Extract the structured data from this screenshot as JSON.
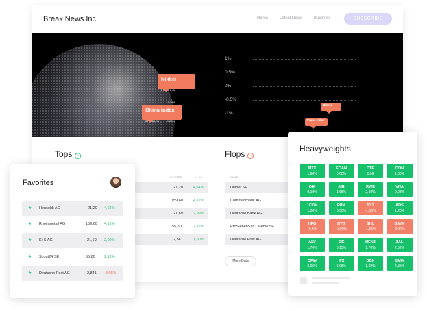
{
  "site": {
    "brand": "Break News Inc",
    "nav": [
      "Home",
      "Latest News",
      "Business"
    ],
    "subscribe": "SUBSCRIBE"
  },
  "hero": {
    "tags": [
      {
        "title": "Nikkei",
        "value": "379.561,45",
        "change": "-1,34%"
      },
      {
        "title": "China Index",
        "value": "379.561,45",
        "change": "-1,09%"
      },
      {
        "title": "Nikkei",
        "value": "379.561,45",
        "change": "-1,34%"
      },
      {
        "title": "China Index",
        "value": "379.561,45",
        "change": "-1,09%"
      }
    ],
    "axis": [
      "1%",
      "0,5%",
      "0%",
      "-0,5%",
      "-1%"
    ]
  },
  "tops": {
    "title": "Tops",
    "headers": [
      "LETZTER",
      "+/- %"
    ],
    "rows": [
      {
        "last": "21,20",
        "change": "4,64%"
      },
      {
        "last": "159,60",
        "change": "4,12%"
      },
      {
        "last": "21,69",
        "change": "2,99%"
      },
      {
        "last": "55,80",
        "change": "2,12%"
      },
      {
        "last": "2,541",
        "change": "1,60%"
      }
    ]
  },
  "flops": {
    "title": "Flops",
    "header": "NAME",
    "rows": [
      "Uniper SE",
      "Commerzbank AG",
      "Deutsche Bank AG",
      "ProSiebenSat 1 Media SE",
      "Deutsche Post AG"
    ],
    "more": "More Data"
  },
  "favorites": {
    "title": "Favorites",
    "rows": [
      {
        "name": "Hensoldt AG",
        "last": "21,20",
        "change": "4,64%",
        "dir": "up"
      },
      {
        "name": "Rheinmetall AG",
        "last": "159,60",
        "change": "4,12%",
        "dir": "up"
      },
      {
        "name": "K+S AG",
        "last": "21,69",
        "change": "2,99%",
        "dir": "up"
      },
      {
        "name": "Scout24 SE",
        "last": "55,80",
        "change": "2,12%",
        "dir": "up"
      },
      {
        "name": "Deutsche Post AG",
        "last": "2,841",
        "change": "-3,65%",
        "dir": "down"
      }
    ]
  },
  "heavyweights": {
    "title": "Heavyweights",
    "tiles": [
      {
        "name": "MTX",
        "change": "1,60%",
        "dir": "up"
      },
      {
        "name": "EOAN",
        "change": "0,60%",
        "dir": "up"
      },
      {
        "name": "DTE",
        "change": "0,09",
        "dir": "up"
      },
      {
        "name": "CON",
        "change": "1,60%",
        "dir": "up"
      },
      {
        "name": "QIA",
        "change": "0,19%",
        "dir": "up"
      },
      {
        "name": "AIR",
        "change": "1,68%",
        "dir": "up"
      },
      {
        "name": "RWE",
        "change": "2,60%",
        "dir": "up"
      },
      {
        "name": "VNA",
        "change": "0,23%",
        "dir": "up"
      },
      {
        "name": "1COV",
        "change": "1,30%",
        "dir": "up"
      },
      {
        "name": "PUM",
        "change": "0,50%",
        "dir": "up"
      },
      {
        "name": "SY1",
        "change": "-1,60%",
        "dir": "down"
      },
      {
        "name": "ADS",
        "change": "1,20%",
        "dir": "up"
      },
      {
        "name": "HFG",
        "change": "-9,6%",
        "dir": "down"
      },
      {
        "name": "DTG",
        "change": "-1,00%",
        "dir": "down"
      },
      {
        "name": "SHL",
        "change": "-1,65%",
        "dir": "down"
      },
      {
        "name": "BAYN",
        "change": "-0,17%",
        "dir": "down"
      },
      {
        "name": "ALV",
        "change": "1,74%",
        "dir": "up"
      },
      {
        "name": "SIE",
        "change": "0,13%",
        "dir": "up"
      },
      {
        "name": "HEN3",
        "change": "1,70%",
        "dir": "up"
      },
      {
        "name": "ZAL",
        "change": "2,02%",
        "dir": "up"
      },
      {
        "name": "DPW",
        "change": "2,05%",
        "dir": "up"
      },
      {
        "name": "IFX",
        "change": "1,08%",
        "dir": "up"
      },
      {
        "name": "DBK",
        "change": "1,02%",
        "dir": "up"
      },
      {
        "name": "BMW",
        "change": "2,35%",
        "dir": "up"
      }
    ]
  },
  "colors": {
    "up": "#17c16c",
    "down": "#f28068",
    "accent": "#d9d6f7"
  }
}
